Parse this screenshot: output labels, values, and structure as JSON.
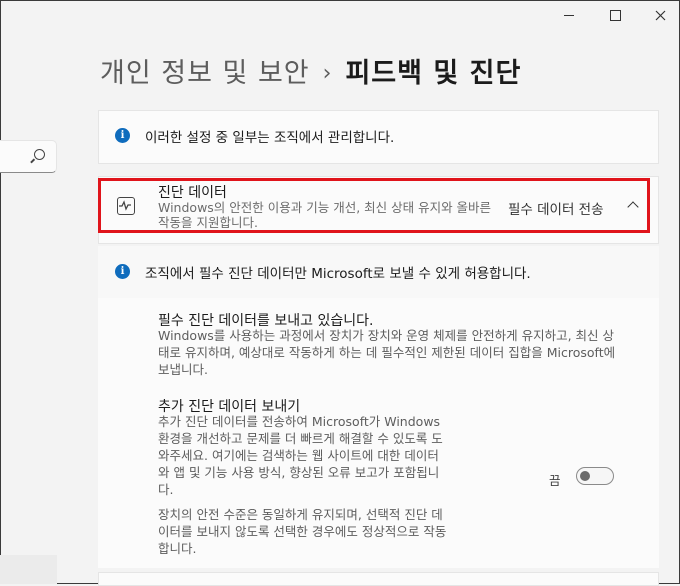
{
  "header": {
    "breadcrumb_parent": "개인 정보 및 보안",
    "separator": "›",
    "page_title": "피드백 및 진단"
  },
  "notice": {
    "icon": "info-icon",
    "text": "이러한 설정 중 일부는 조직에서 관리합니다."
  },
  "diagnostic": {
    "icon": "activity-pulse-icon",
    "title": "진단 데이터",
    "description": "Windows의 안전한 이용과 기능 개선, 최신 상태 유지와 올바른 작동을 지원합니다.",
    "value": "필수 데이터 전송",
    "expanded": true
  },
  "org_notice": {
    "icon": "info-icon",
    "text": "조직에서 필수 진단 데이터만 Microsoft로 보낼 수 있게 허용합니다."
  },
  "required_data": {
    "title": "필수 진단 데이터를 보내고 있습니다.",
    "description": "Windows를 사용하는 과정에서 장치가 장치와 운영 체제를 안전하게 유지하고, 최신 상태로 유지하며, 예상대로 작동하게 하는 데 필수적인 제한된 데이터 집합을 Microsoft에 보냅니다."
  },
  "optional_data": {
    "title": "추가 진단 데이터 보내기",
    "description_1": "추가 진단 데이터를 전송하여 Microsoft가 Windows 환경을 개선하고 문제를 더 빠르게 해결할 수 있도록 도와주세요. 여기에는 검색하는 웹 사이트에 대한 데이터와 앱 및 기능 사용 방식, 향상된 오류 보고가 포함됩니다.",
    "description_2": "장치의 안전 수준은 동일하게 유지되며, 선택적 진단 데이터를 보내지 않도록 선택한 경우에도 정상적으로 작동합니다.",
    "toggle_label": "끔",
    "toggle_on": false
  },
  "colors": {
    "accent": "#0f6cbd",
    "highlight": "#e0141b"
  }
}
